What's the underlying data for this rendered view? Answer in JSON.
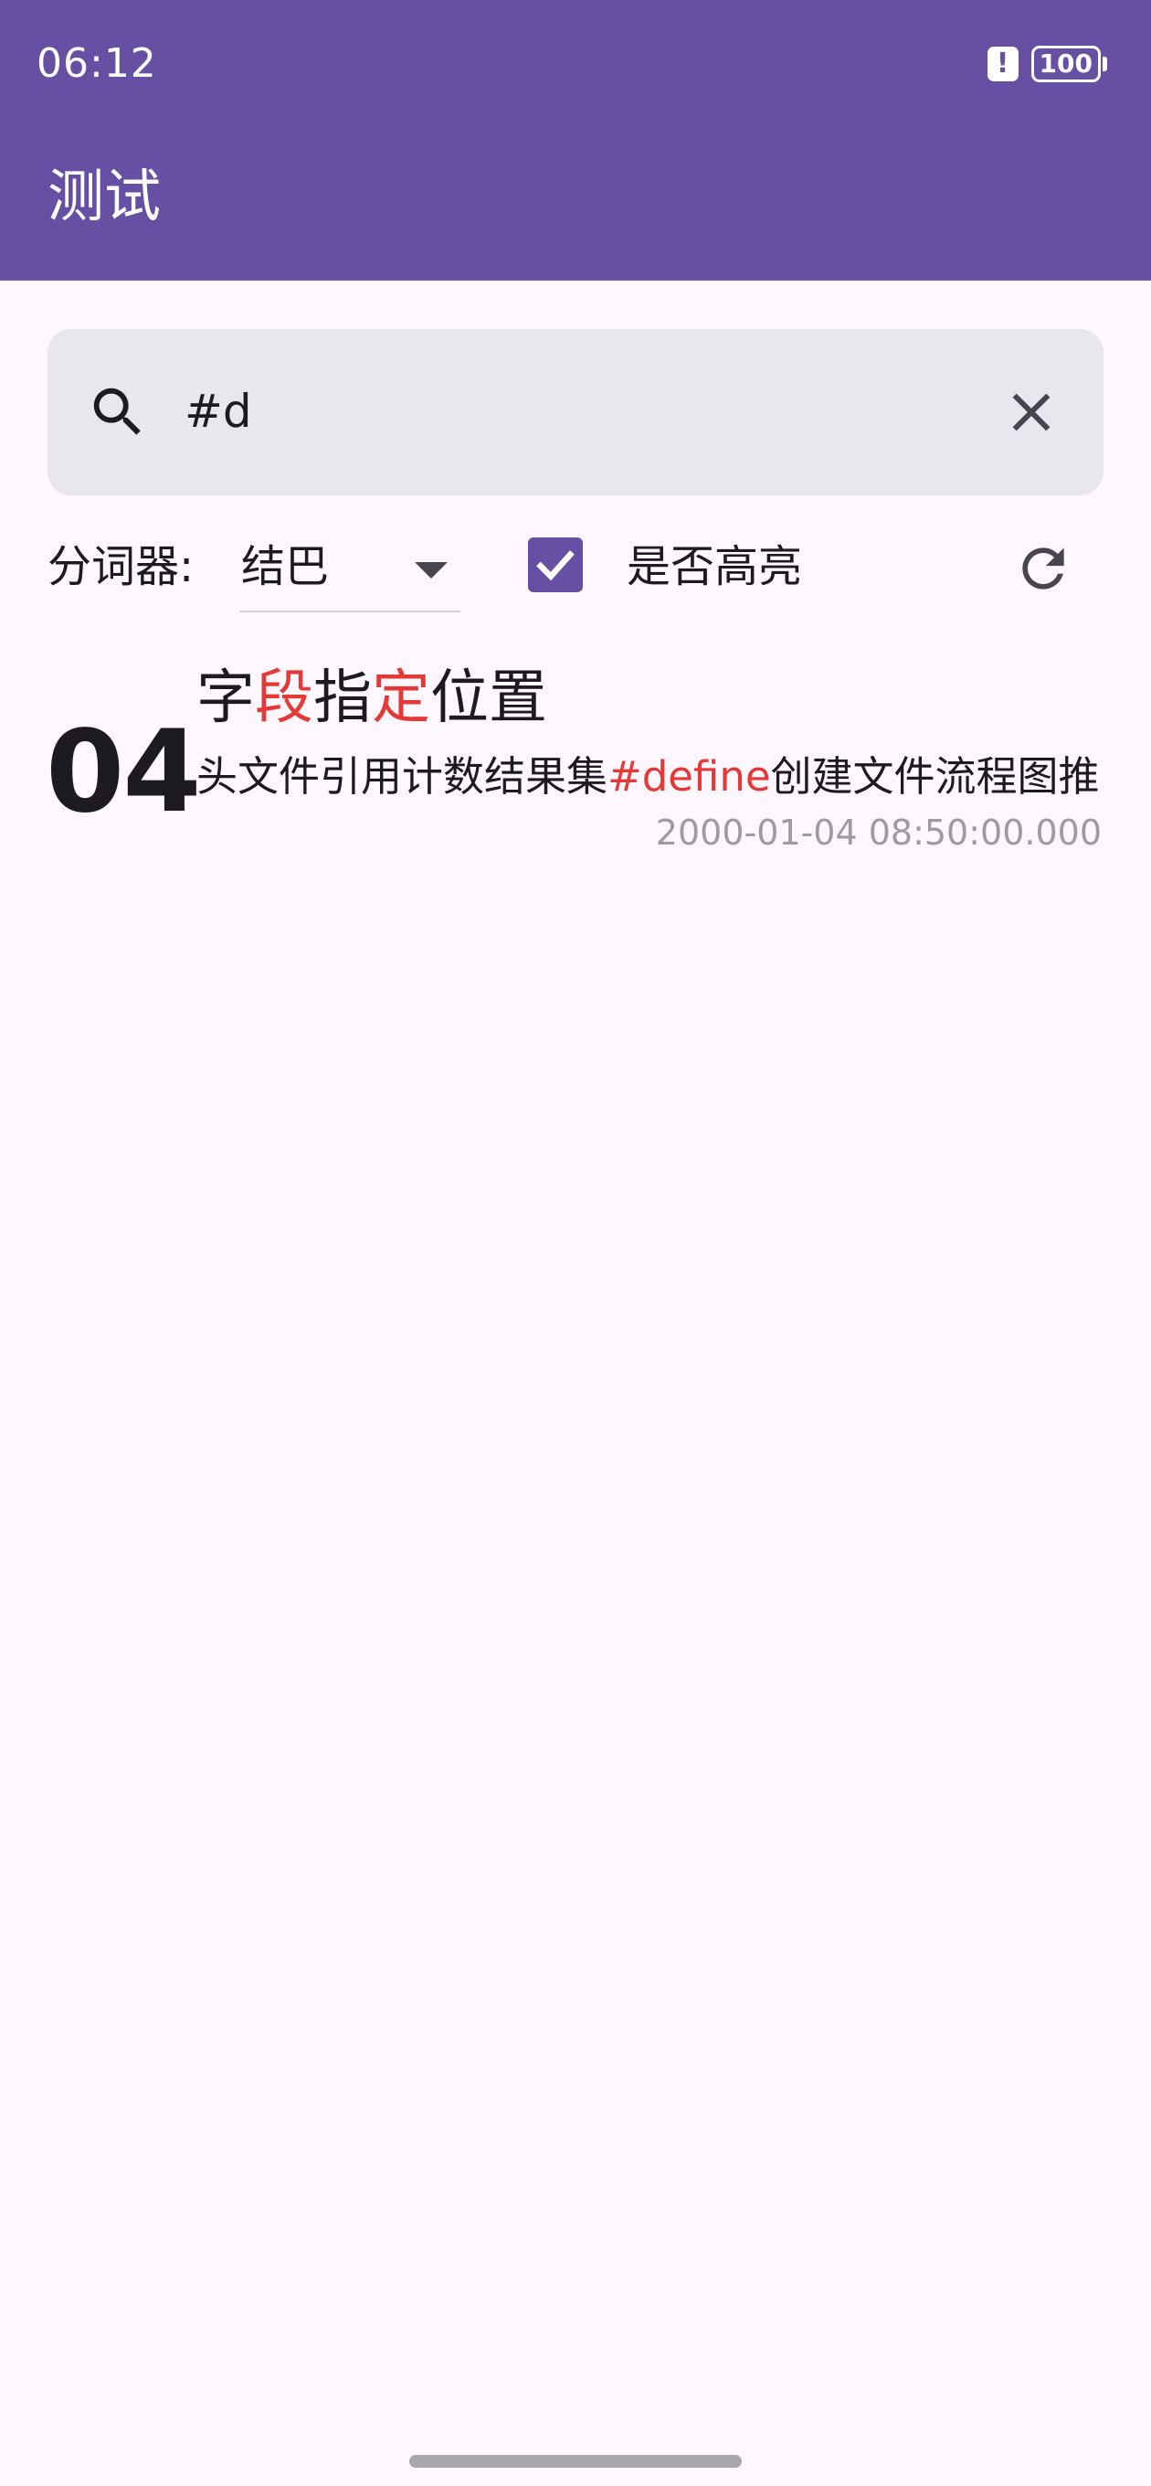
{
  "status_bar": {
    "time": "06:12",
    "battery": "100"
  },
  "app_bar": {
    "title": "测试"
  },
  "search": {
    "value": "#d"
  },
  "options": {
    "tokenizer_label": "分词器:",
    "tokenizer_value": "结巴",
    "highlight_checked": true,
    "highlight_label": "是否高亮"
  },
  "results": [
    {
      "number": "04",
      "title_parts": [
        "字",
        "段",
        "指",
        "定",
        "位置"
      ],
      "content_parts": [
        "头文件引用计数结果集",
        "#define",
        "创建文件流程图推"
      ],
      "timestamp": "2000-01-04 08:50:00.000"
    }
  ],
  "colors": {
    "primary": "#6750A4",
    "highlight": "#E53935",
    "background": "#FEF7FF"
  }
}
